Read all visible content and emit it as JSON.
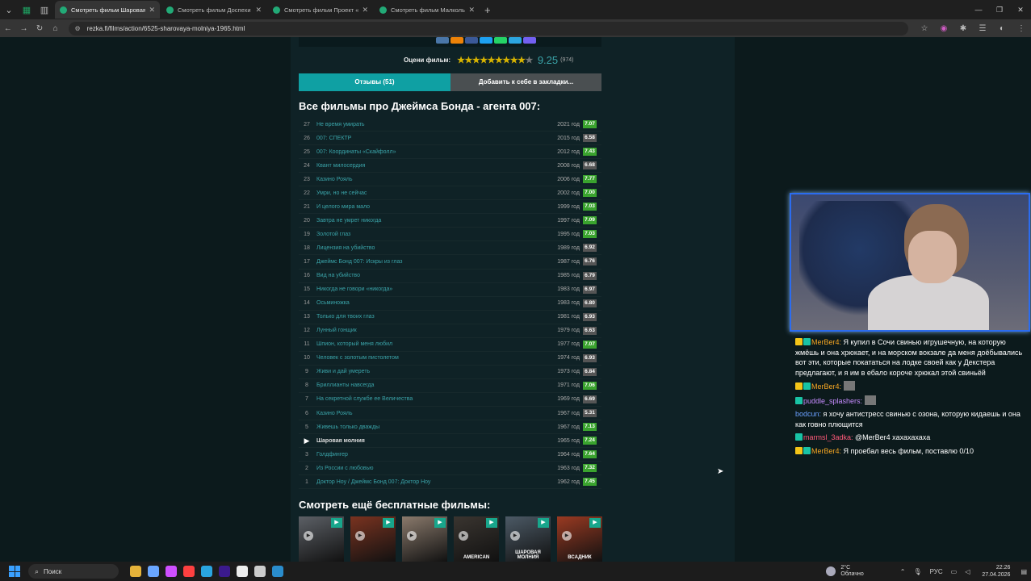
{
  "browser": {
    "tabs": [
      {
        "title": "Смотреть фильм Шаровая мо...",
        "active": true
      },
      {
        "title": "Смотреть фильм Доспехи Бог...",
        "active": false
      },
      {
        "title": "Смотреть фильм Проект «Ала...",
        "active": false
      },
      {
        "title": "Смотреть фильм Малкольм И...",
        "active": false
      }
    ],
    "url": "rezka.fi/films/action/6525-sharovaya-molniya-1965.html"
  },
  "rating": {
    "label": "Оцени фильм:",
    "score": "9.25",
    "count": "(974)",
    "stars_filled": 9,
    "stars_total": 10
  },
  "buttons": {
    "reviews": "Отзывы (51)",
    "bookmark": "Добавить к себе в закладки..."
  },
  "franchise": {
    "title": "Все фильмы про Джеймса Бонда - агента 007:",
    "items": [
      {
        "num": "27",
        "title": "Не время умирать",
        "year": "2021 год",
        "score": "7.07",
        "color": "#3aa32e"
      },
      {
        "num": "26",
        "title": "007: СПЕКТР",
        "year": "2015 год",
        "score": "6.58",
        "color": "#555"
      },
      {
        "num": "25",
        "title": "007: Координаты «Скайфолл»",
        "year": "2012 год",
        "score": "7.43",
        "color": "#3aa32e"
      },
      {
        "num": "24",
        "title": "Квант милосердия",
        "year": "2008 год",
        "score": "6.68",
        "color": "#555"
      },
      {
        "num": "23",
        "title": "Казино Рояль",
        "year": "2006 год",
        "score": "7.77",
        "color": "#3aa32e"
      },
      {
        "num": "22",
        "title": "Умри, но не сейчас",
        "year": "2002 год",
        "score": "7.00",
        "color": "#3aa32e"
      },
      {
        "num": "21",
        "title": "И целого мира мало",
        "year": "1999 год",
        "score": "7.03",
        "color": "#3aa32e"
      },
      {
        "num": "20",
        "title": "Завтра не умрет никогда",
        "year": "1997 год",
        "score": "7.09",
        "color": "#3aa32e"
      },
      {
        "num": "19",
        "title": "Золотой глаз",
        "year": "1995 год",
        "score": "7.03",
        "color": "#3aa32e"
      },
      {
        "num": "18",
        "title": "Лицензия на убийство",
        "year": "1989 год",
        "score": "6.92",
        "color": "#555"
      },
      {
        "num": "17",
        "title": "Джеймс Бонд 007: Искры из глаз",
        "year": "1987 год",
        "score": "6.76",
        "color": "#555"
      },
      {
        "num": "16",
        "title": "Вид на убийство",
        "year": "1985 год",
        "score": "6.79",
        "color": "#555"
      },
      {
        "num": "15",
        "title": "Никогда не говори «никогда»",
        "year": "1983 год",
        "score": "6.97",
        "color": "#555"
      },
      {
        "num": "14",
        "title": "Осьминожка",
        "year": "1983 год",
        "score": "6.80",
        "color": "#555"
      },
      {
        "num": "13",
        "title": "Только для твоих глаз",
        "year": "1981 год",
        "score": "6.93",
        "color": "#555"
      },
      {
        "num": "12",
        "title": "Лунный гонщик",
        "year": "1979 год",
        "score": "6.63",
        "color": "#555"
      },
      {
        "num": "11",
        "title": "Шпион, который меня любил",
        "year": "1977 год",
        "score": "7.07",
        "color": "#3aa32e"
      },
      {
        "num": "10",
        "title": "Человек с золотым пистолетом",
        "year": "1974 год",
        "score": "6.93",
        "color": "#555"
      },
      {
        "num": "9",
        "title": "Живи и дай умереть",
        "year": "1973 год",
        "score": "6.84",
        "color": "#555"
      },
      {
        "num": "8",
        "title": "Бриллианты навсегда",
        "year": "1971 год",
        "score": "7.06",
        "color": "#3aa32e"
      },
      {
        "num": "7",
        "title": "На секретной службе ее Величества",
        "year": "1969 год",
        "score": "6.69",
        "color": "#555"
      },
      {
        "num": "6",
        "title": "Казино Рояль",
        "year": "1967 год",
        "score": "5.31",
        "color": "#555"
      },
      {
        "num": "5",
        "title": "Живешь только дважды",
        "year": "1967 год",
        "score": "7.13",
        "color": "#3aa32e"
      },
      {
        "num": "",
        "title": "Шаровая молния",
        "year": "1965 год",
        "score": "7.24",
        "color": "#3aa32e",
        "current": true
      },
      {
        "num": "3",
        "title": "Голдфингер",
        "year": "1964 год",
        "score": "7.64",
        "color": "#3aa32e"
      },
      {
        "num": "2",
        "title": "Из России с любовью",
        "year": "1963 год",
        "score": "7.32",
        "color": "#3aa32e"
      },
      {
        "num": "1",
        "title": "Доктор Ноу / Джеймс Бонд 007: Доктор Ноу",
        "year": "1962 год",
        "score": "7.45",
        "color": "#3aa32e"
      }
    ]
  },
  "more": {
    "title": "Смотреть ещё бесплатные фильмы:",
    "posters": [
      {
        "text": "",
        "bg": "#5c6066"
      },
      {
        "text": "",
        "bg": "#7a3320"
      },
      {
        "text": "",
        "bg": "#8a7a6c"
      },
      {
        "text": "AMERICAN",
        "bg": "#3a3530"
      },
      {
        "text": "ШАРОВАЯ МОЛНИЯ",
        "bg": "#4c5a66"
      },
      {
        "text": "ВСАДНИК",
        "bg": "#9a3a22"
      }
    ]
  },
  "chat": [
    {
      "nick": "MerBer4:",
      "nick_color": "#f5a623",
      "text": " Я купил в Сочи свинью игрушечную, на которую жмёшь и она хрюкает, и на морском вокзале да меня доёбывались вот эти, которые покататься на лодке своей как у Декстера предлагают, и я им в ебало короче хрюкал этой свиньёй",
      "badges": [
        "#f5c518",
        "#19c3a5"
      ],
      "emote": false
    },
    {
      "nick": "MerBer4:",
      "nick_color": "#f5a623",
      "text": "",
      "badges": [
        "#f5c518",
        "#19c3a5"
      ],
      "emote": true
    },
    {
      "nick": "puddle_splashers:",
      "nick_color": "#c78cff",
      "text": "",
      "badges": [
        "#19c3a5"
      ],
      "emote": true
    },
    {
      "nick": "bodcun:",
      "nick_color": "#6aa0ff",
      "text": " я хочу антистресс свинью с озона, которую кидаешь и она как говно плющится",
      "badges": [],
      "emote": false
    },
    {
      "nick": "marmsl_3adka:",
      "nick_color": "#ff5a7a",
      "text": " @MerBer4 хахахахаха",
      "badges": [
        "#19c3a5"
      ],
      "emote": false
    },
    {
      "nick": "MerBer4:",
      "nick_color": "#f5a623",
      "text": " Я проебал весь фильм, поставлю 0/10",
      "badges": [
        "#f5c518",
        "#19c3a5"
      ],
      "emote": false
    }
  ],
  "taskbar": {
    "search": "Поиск",
    "weather_temp": "2°C",
    "weather_desc": "Облачно",
    "lang": "РУС",
    "time": "22:26",
    "date": "27.04.2026"
  }
}
